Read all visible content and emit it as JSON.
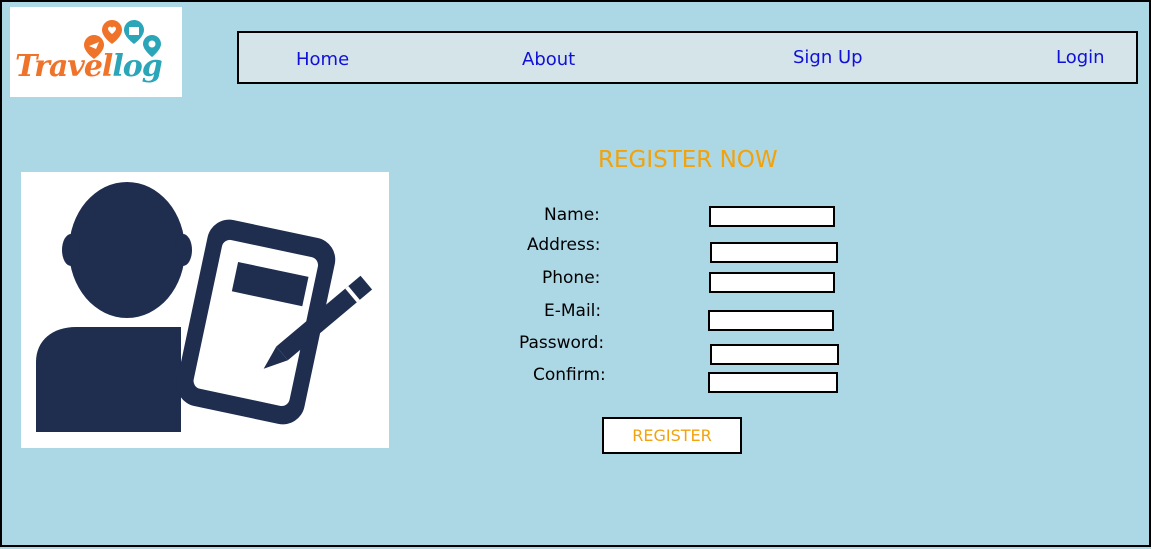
{
  "logo": {
    "text": "Travellog",
    "text_parts": [
      "Travel",
      "log"
    ]
  },
  "nav": {
    "items": [
      {
        "label": "Home"
      },
      {
        "label": "About"
      },
      {
        "label": "Sign Up"
      },
      {
        "label": "Login"
      }
    ]
  },
  "form": {
    "title": "REGISTER NOW",
    "fields": [
      {
        "label": "Name:",
        "value": ""
      },
      {
        "label": "Address:",
        "value": ""
      },
      {
        "label": "Phone:",
        "value": ""
      },
      {
        "label": "E-Mail:",
        "value": ""
      },
      {
        "label": "Password:",
        "value": ""
      },
      {
        "label": "Confirm:",
        "value": ""
      }
    ],
    "submit_label": "REGISTER"
  },
  "colors": {
    "page_bg": "#acd7e5",
    "nav_bg": "#d5e4e8",
    "nav_link": "#1010d8",
    "accent": "#f2a20c",
    "logo_orange": "#f0732a",
    "logo_teal": "#2aa6b8",
    "icon_navy": "#1f2d4f"
  },
  "icons": [
    "travel-pins-icon",
    "user-register-icon"
  ]
}
